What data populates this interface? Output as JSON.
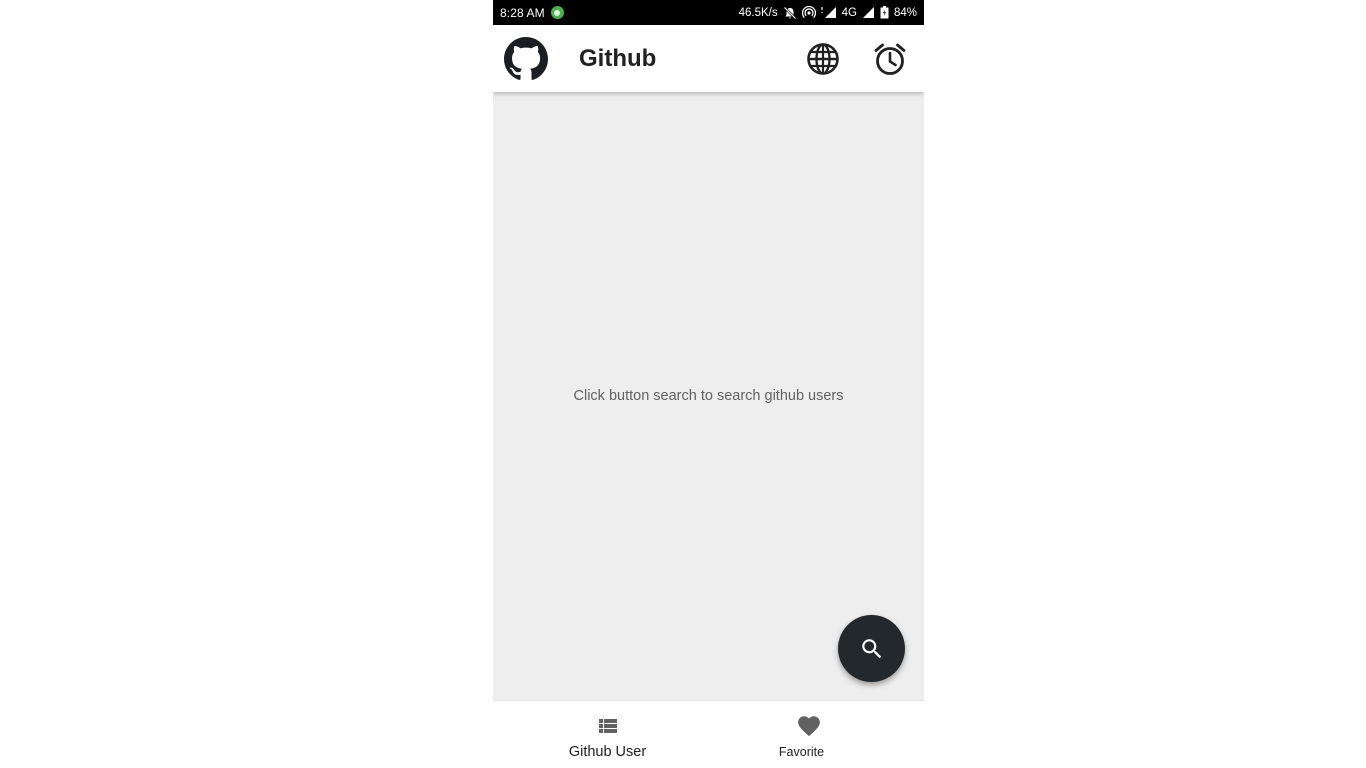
{
  "status_bar": {
    "time": "8:28 AM",
    "network_speed": "46.5K/s",
    "network_type": "4G",
    "battery": "84%",
    "icons": [
      "notification-dot-icon",
      "mute-icon",
      "hotspot-icon",
      "signal-icon",
      "signal-icon",
      "battery-icon"
    ]
  },
  "app_bar": {
    "title": "Github",
    "logo_icon": "github-logo-icon",
    "actions": [
      {
        "name": "language-button",
        "icon": "globe-icon"
      },
      {
        "name": "reminder-button",
        "icon": "alarm-clock-icon"
      }
    ]
  },
  "main": {
    "empty_message": "Click button search to search github users"
  },
  "fab": {
    "icon": "search-icon",
    "color": "#22282c"
  },
  "bottom_nav": {
    "items": [
      {
        "label": "Github User",
        "icon": "list-icon"
      },
      {
        "label": "Favorite",
        "icon": "heart-icon"
      }
    ]
  },
  "colors": {
    "status_bar": "#000000",
    "app_bar": "#ffffff",
    "background": "#eeeeee",
    "fab": "#22282c",
    "text_primary": "#212121",
    "text_secondary": "#616161"
  }
}
